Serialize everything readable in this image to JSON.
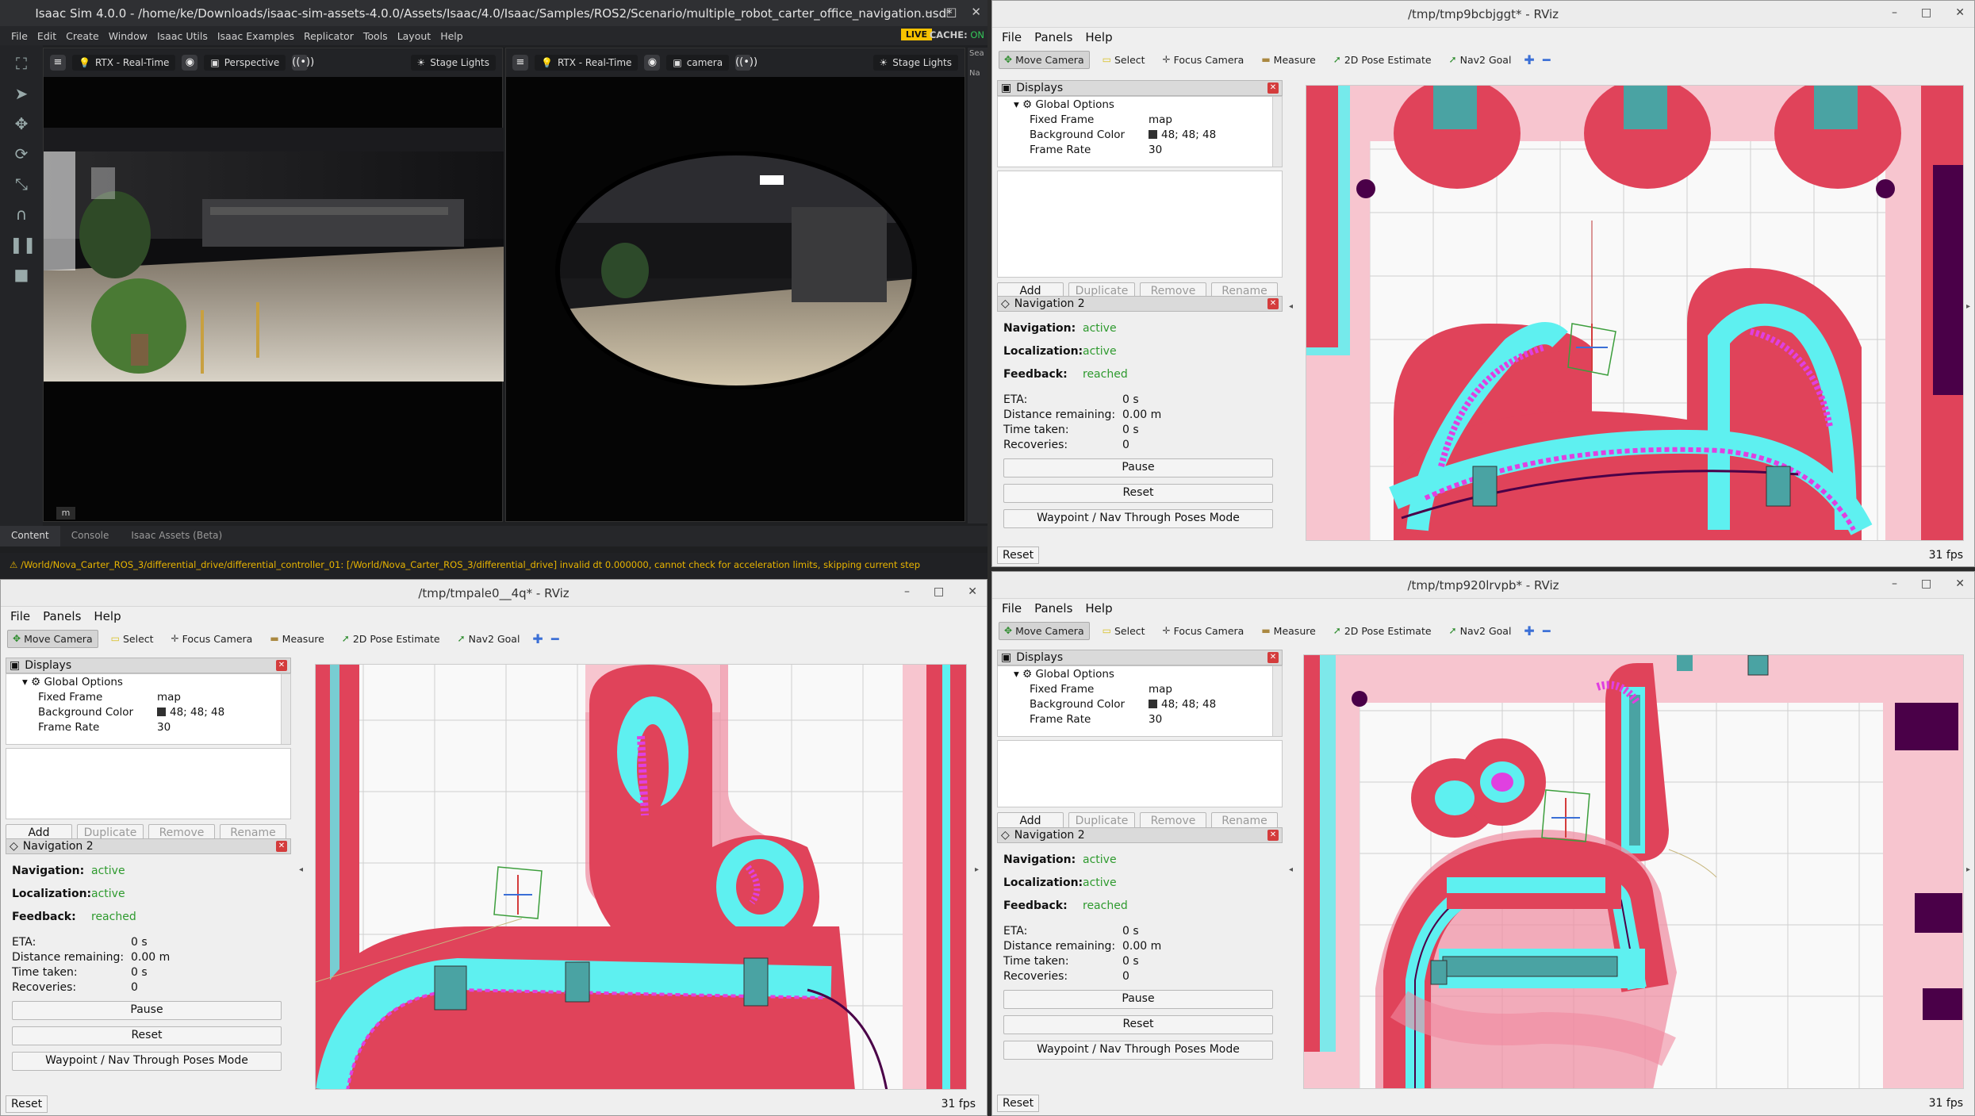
{
  "isaac": {
    "title": "Isaac Sim 4.0.0 - /home/ke/Downloads/isaac-sim-assets-4.0.0/Assets/Isaac/4.0/Isaac/Samples/ROS2/Scenario/multiple_robot_carter_office_navigation.usd*",
    "window_controls": [
      "–",
      "□",
      "✕"
    ],
    "menu": [
      "File",
      "Edit",
      "Create",
      "Window",
      "Isaac Utils",
      "Isaac Examples",
      "Replicator",
      "Tools",
      "Layout",
      "Help"
    ],
    "live_label": "LIVE",
    "cache_label": "CACHE:",
    "cache_state": "ON",
    "viewport_left": {
      "render_mode": "RTX - Real-Time",
      "camera": "Perspective",
      "lights": "Stage Lights",
      "unit_badge": "m"
    },
    "viewport_right": {
      "render_mode": "RTX - Real-Time",
      "camera": "camera",
      "lights": "Stage Lights"
    },
    "side_search": "Sea",
    "side_name": "Na",
    "tabs": [
      "Content",
      "Console",
      "Isaac Assets (Beta)"
    ],
    "status_message": "/World/Nova_Carter_ROS_3/differential_drive/differential_controller_01: [/World/Nova_Carter_ROS_3/differential_drive] invalid dt 0.000000, cannot check for acceleration limits, skipping current step"
  },
  "rviz_common": {
    "menu": [
      "File",
      "Panels",
      "Help"
    ],
    "tools": [
      "Move Camera",
      "Select",
      "Focus Camera",
      "Measure",
      "2D Pose Estimate",
      "Nav2 Goal"
    ],
    "displays_header": "Displays",
    "global_options": "Global Options",
    "props": [
      {
        "k": "Fixed Frame",
        "v": "map"
      },
      {
        "k": "Background Color",
        "v": "48; 48; 48"
      },
      {
        "k": "Frame Rate",
        "v": "30"
      }
    ],
    "display_buttons": [
      "Add",
      "Duplicate",
      "Remove",
      "Rename"
    ],
    "nav_header": "Navigation 2",
    "nav_labels": {
      "navigation": "Navigation:",
      "localization": "Localization:",
      "feedback": "Feedback:"
    },
    "nav_values": {
      "navigation": "active",
      "localization": "active",
      "feedback": "reached"
    },
    "stats": [
      {
        "k": "ETA:",
        "v": "0 s"
      },
      {
        "k": "Distance remaining:",
        "v": "0.00 m"
      },
      {
        "k": "Time taken:",
        "v": "0 s"
      },
      {
        "k": "Recoveries:",
        "v": "0"
      }
    ],
    "pause": "Pause",
    "reset": "Reset",
    "waypoint": "Waypoint / Nav Through Poses Mode",
    "reset_bottom": "Reset",
    "fps": "31 fps"
  },
  "rviz_tr": {
    "title": "/tmp/tmp9bcbjggt* - RViz"
  },
  "rviz_bl": {
    "title": "/tmp/tmpale0__4q* - RViz"
  },
  "rviz_br": {
    "title": "/tmp/tmp920lrvpb* - RViz"
  },
  "colors": {
    "lethal": "#e0435a",
    "inflated": "#f08aa0",
    "pale": "#f7c5cf",
    "cyan": "#5ef0f0",
    "magenta": "#e040e0",
    "wall": "#4a0048",
    "teal": "#4aa3a3"
  }
}
